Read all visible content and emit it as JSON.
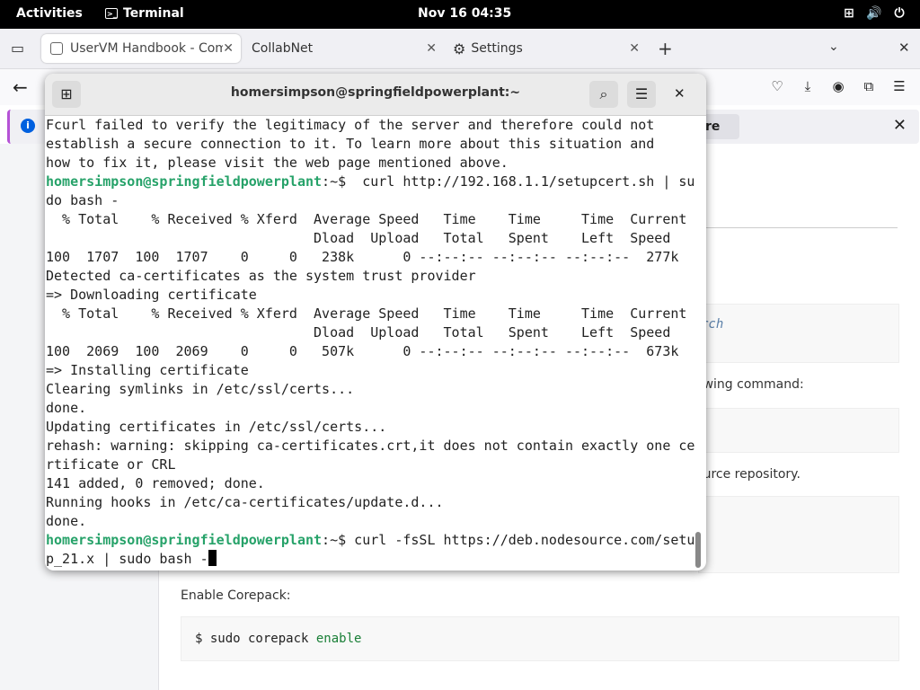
{
  "topbar": {
    "activities": "Activities",
    "app": "Terminal",
    "clock": "Nov 16  04:35"
  },
  "browser": {
    "tabs": [
      {
        "label": "UserVM Handbook - Com"
      },
      {
        "label": "CollabNet"
      },
      {
        "label": "Settings"
      }
    ],
    "infobar_button": "re"
  },
  "page": {
    "search_hint": "rch",
    "text1": "owing command:",
    "text2": "ource repository.",
    "text3": "Enable Corepack:",
    "code3_a": "$ sudo corepack ",
    "code3_b": "enable"
  },
  "terminal": {
    "title": "homersimpson@springfieldpowerplant:~",
    "lines": [
      {
        "t": "Fcurl failed to verify the legitimacy of the server and therefore could not"
      },
      {
        "t": "establish a secure connection to it. To learn more about this situation and"
      },
      {
        "t": "how to fix it, please visit the web page mentioned above."
      },
      {
        "p": "homersimpson@springfieldpowerplant",
        "t": ":~$  curl http://192.168.1.1/setupcert.sh | su"
      },
      {
        "t": "do bash -"
      },
      {
        "t": "  % Total    % Received % Xferd  Average Speed   Time    Time     Time  Current"
      },
      {
        "t": "                                 Dload  Upload   Total   Spent    Left  Speed"
      },
      {
        "t": "100  1707  100  1707    0     0   238k      0 --:--:-- --:--:-- --:--:--  277k"
      },
      {
        "t": "Detected ca-certificates as the system trust provider"
      },
      {
        "t": "=> Downloading certificate"
      },
      {
        "t": "  % Total    % Received % Xferd  Average Speed   Time    Time     Time  Current"
      },
      {
        "t": "                                 Dload  Upload   Total   Spent    Left  Speed"
      },
      {
        "t": "100  2069  100  2069    0     0   507k      0 --:--:-- --:--:-- --:--:--  673k"
      },
      {
        "t": "=> Installing certificate"
      },
      {
        "t": "Clearing symlinks in /etc/ssl/certs..."
      },
      {
        "t": "done."
      },
      {
        "t": "Updating certificates in /etc/ssl/certs..."
      },
      {
        "t": "rehash: warning: skipping ca-certificates.crt,it does not contain exactly one ce"
      },
      {
        "t": "rtificate or CRL"
      },
      {
        "t": "141 added, 0 removed; done."
      },
      {
        "t": "Running hooks in /etc/ca-certificates/update.d..."
      },
      {
        "t": "done."
      },
      {
        "p": "homersimpson@springfieldpowerplant",
        "t": ":~$ curl -fsSL https://deb.nodesource.com/setu"
      },
      {
        "t": "p_21.x | sudo bash -",
        "cursor": true
      }
    ]
  }
}
